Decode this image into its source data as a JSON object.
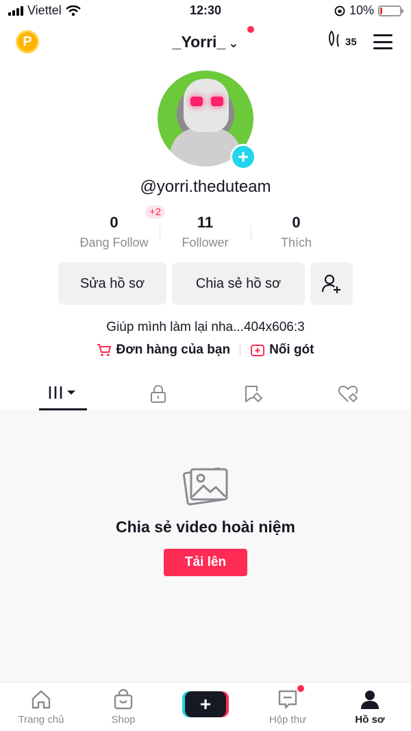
{
  "status_bar": {
    "carrier": "Viettel",
    "time": "12:30",
    "battery": "10%",
    "battery_level": 0.1
  },
  "header": {
    "username": "_Yorri_",
    "steps_count": "35",
    "coin_letter": "P"
  },
  "profile": {
    "handle": "@yorri.theduteam",
    "bio": "Giúp mình làm lại nha...404x606:3"
  },
  "stats": {
    "following": {
      "value": "0",
      "label": "Đang Follow"
    },
    "followers": {
      "value": "11",
      "label": "Follower",
      "delta": "+2"
    },
    "likes": {
      "value": "0",
      "label": "Thích"
    }
  },
  "actions": {
    "edit": "Sửa hồ sơ",
    "share": "Chia sẻ hồ sơ"
  },
  "links": {
    "orders": "Đơn hàng của bạn",
    "heel": "Nối gót"
  },
  "empty_state": {
    "title": "Chia sẻ video hoài niệm",
    "button": "Tải lên"
  },
  "nav": {
    "home": "Trang chủ",
    "shop": "Shop",
    "inbox": "Hộp thư",
    "profile": "Hồ sơ"
  },
  "colors": {
    "accent": "#fe2c55",
    "cyan": "#20d5ec",
    "text": "#161823",
    "muted": "#8a8b91"
  }
}
